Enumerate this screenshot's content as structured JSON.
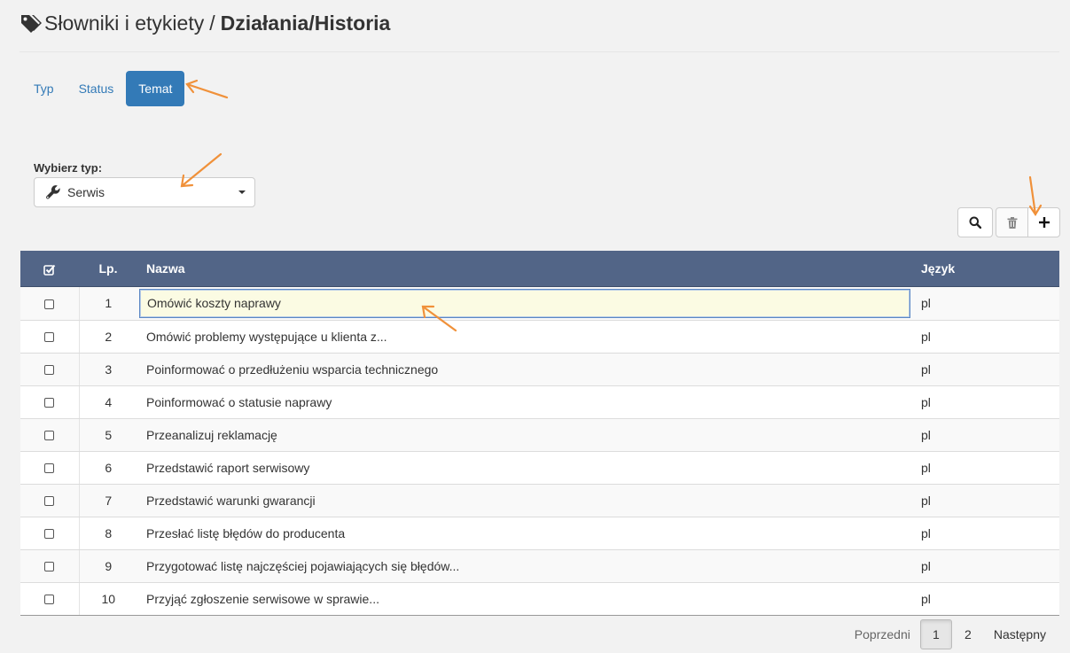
{
  "header": {
    "section": "Słowniki i etykiety",
    "separator": "/",
    "current": "Działania/Historia"
  },
  "tabs": [
    {
      "label": "Typ",
      "active": false
    },
    {
      "label": "Status",
      "active": false
    },
    {
      "label": "Temat",
      "active": true
    }
  ],
  "type_select": {
    "label": "Wybierz typ:",
    "value": "Serwis",
    "icon": "wrench-icon"
  },
  "toolbar": {
    "search_icon": "search-icon",
    "delete_icon": "trash-icon",
    "add_icon": "plus-icon"
  },
  "table": {
    "columns": {
      "lp": "Lp.",
      "name": "Nazwa",
      "lang": "Język"
    },
    "rows": [
      {
        "lp": "1",
        "name": "Omówić koszty naprawy",
        "lang": "pl",
        "editing": true
      },
      {
        "lp": "2",
        "name": "Omówić problemy występujące u klienta z...",
        "lang": "pl"
      },
      {
        "lp": "3",
        "name": "Poinformować o przedłużeniu wsparcia technicznego",
        "lang": "pl"
      },
      {
        "lp": "4",
        "name": "Poinformować o statusie naprawy",
        "lang": "pl"
      },
      {
        "lp": "5",
        "name": "Przeanalizuj reklamację",
        "lang": "pl"
      },
      {
        "lp": "6",
        "name": "Przedstawić raport serwisowy",
        "lang": "pl"
      },
      {
        "lp": "7",
        "name": "Przedstawić warunki gwarancji",
        "lang": "pl"
      },
      {
        "lp": "8",
        "name": "Przesłać listę błędów do producenta",
        "lang": "pl"
      },
      {
        "lp": "9",
        "name": "Przygotować listę najczęściej pojawiających się błędów...",
        "lang": "pl"
      },
      {
        "lp": "10",
        "name": "Przyjąć zgłoszenie serwisowe w sprawie...",
        "lang": "pl"
      }
    ]
  },
  "pagination": {
    "prev": "Poprzedni",
    "pages": [
      "1",
      "2"
    ],
    "current": "1",
    "next": "Następny"
  },
  "colors": {
    "accent": "#337ab7",
    "table_header": "#526587",
    "annotation_arrow": "#f0913a",
    "edit_bg": "#fbfbe3"
  }
}
